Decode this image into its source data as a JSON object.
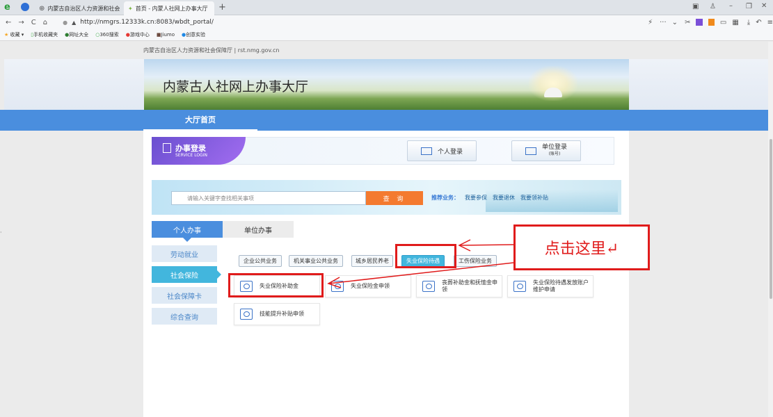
{
  "browser": {
    "tabs": [
      {
        "title": "内蒙古自治区人力资源和社会",
        "active": false
      },
      {
        "title": "首页 - 内蒙人社网上办事大厅",
        "active": true
      }
    ],
    "url": "http://nmgrs.12333k.cn:8083/wbdt_portal/",
    "bookmarks": [
      "收藏",
      "手机收藏夹",
      "网址大全",
      "360搜索",
      "游戏中心",
      "Jiumo",
      "创意实验"
    ]
  },
  "page": {
    "top_links": "内蒙古自治区人力资源和社会保障厅 | rst.nmg.gov.cn",
    "site_title": "内蒙古人社网上办事大厅",
    "nav_home": "大厅首页",
    "login": {
      "title": "办事登录",
      "subtitle": "SERVICE LOGIN",
      "personal": "个人登录",
      "unit": "单位登录",
      "unit_sub": "(账号)"
    },
    "search": {
      "placeholder": "请输入关键字查找相关事项",
      "button": "查 询",
      "recommend_label": "推荐业务：",
      "recommend_items": [
        "我要参保",
        "我要退休",
        "我要领补贴"
      ]
    },
    "main_tabs": [
      "个人办事",
      "单位办事"
    ],
    "side_menu": [
      "劳动就业",
      "社会保险",
      "社会保障卡",
      "综合查询"
    ],
    "categories": [
      "企业公共业务",
      "机关事业公共业务",
      "城乡居民养老",
      "失业保险待遇",
      "工伤保险业务"
    ],
    "cards": [
      "失业保险补助金",
      "失业保险金申领",
      "丧葬补助金和抚恤金申领",
      "失业保险待遇发放账户维护申请",
      "技能提升补贴申领"
    ],
    "annotation": "点击这里↵"
  },
  "colors": {
    "nav_blue": "#4a8ede",
    "accent_cyan": "#42b6dd",
    "search_orange": "#f47a2f",
    "annotation_red": "#e01b1b"
  }
}
